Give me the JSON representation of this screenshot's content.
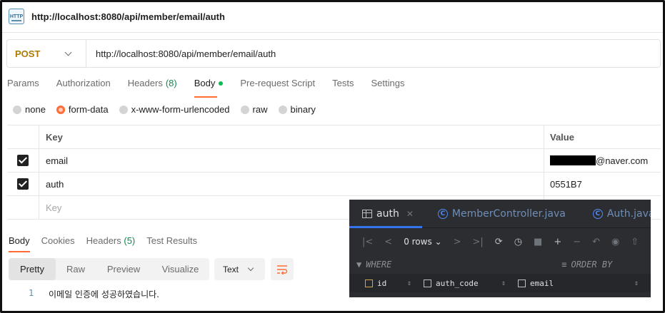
{
  "title": "http://localhost:8080/api/member/email/auth",
  "request": {
    "method": "POST",
    "url": "http://localhost:8080/api/member/email/auth"
  },
  "request_tabs": [
    {
      "label": "Params"
    },
    {
      "label": "Authorization"
    },
    {
      "label": "Headers",
      "count": "(8)"
    },
    {
      "label": "Body",
      "active": true
    },
    {
      "label": "Pre-request Script"
    },
    {
      "label": "Tests"
    },
    {
      "label": "Settings"
    }
  ],
  "body_types": [
    "none",
    "form-data",
    "x-www-form-urlencoded",
    "raw",
    "binary"
  ],
  "body_selected": "form-data",
  "kv_table": {
    "key_header": "Key",
    "value_header": "Value",
    "rows": [
      {
        "key": "email",
        "value": "@naver.com",
        "checked": true
      },
      {
        "key": "auth",
        "value": "0551B7",
        "checked": true
      }
    ],
    "placeholder_key": "Key"
  },
  "response_tabs": {
    "body": "Body",
    "cookies": "Cookies",
    "headers": "Headers",
    "headers_count": "(5)",
    "test_results": "Test Results"
  },
  "format_buttons": [
    "Pretty",
    "Raw",
    "Preview",
    "Visualize"
  ],
  "format_type": "Text",
  "response_body": {
    "line_number": "1",
    "text": "이메일 인증에 성공하였습니다."
  },
  "ide": {
    "tabs": [
      {
        "label": "auth",
        "icon": "table-icon",
        "active": true
      },
      {
        "label": "MemberController.java",
        "icon": "class-icon"
      },
      {
        "label": "Auth.java",
        "icon": "class-icon"
      }
    ],
    "rows_label": "0 rows",
    "where_label": "WHERE",
    "order_label": "ORDER BY",
    "columns": [
      "id",
      "auth_code",
      "email"
    ]
  },
  "colors": {
    "accent": "#ff6c37",
    "method": "#ad7a03",
    "count": "#0f8a4d",
    "ide_bg": "#2b2d30"
  }
}
